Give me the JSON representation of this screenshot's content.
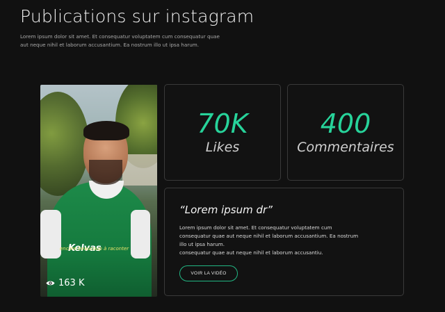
{
  "header": {
    "title": "Publications sur instagram",
    "intro": "Lorem ipsum dolor sit amet. Et consequatur voluptatem cum consequatur quae aut neque nihil et laborum accusantium. Ea nostrum illo ut ipsa harum."
  },
  "video": {
    "caption": "encore beaucoup à raconter",
    "jersey_text": "Kelvas",
    "views": "163 K",
    "views_icon": "eye-icon"
  },
  "stats": [
    {
      "value": "70K",
      "label": "Likes"
    },
    {
      "value": "400",
      "label": "Commentaires"
    }
  ],
  "feature": {
    "quote": "“Lorem ipsum dr”",
    "body": "Lorem ipsum dolor sit amet. Et consequatur voluptatem cum consequatur quae aut neque nihil et laborum accusantium. Ea nostrum illo ut ipsa harum.\nconsequatur quae aut neque nihil et laborum accusantiu.",
    "button_label": "VOIR LA VIDÉO"
  },
  "colors": {
    "background": "#111111",
    "accent": "#27d39a",
    "border": "#3a3a3a"
  }
}
